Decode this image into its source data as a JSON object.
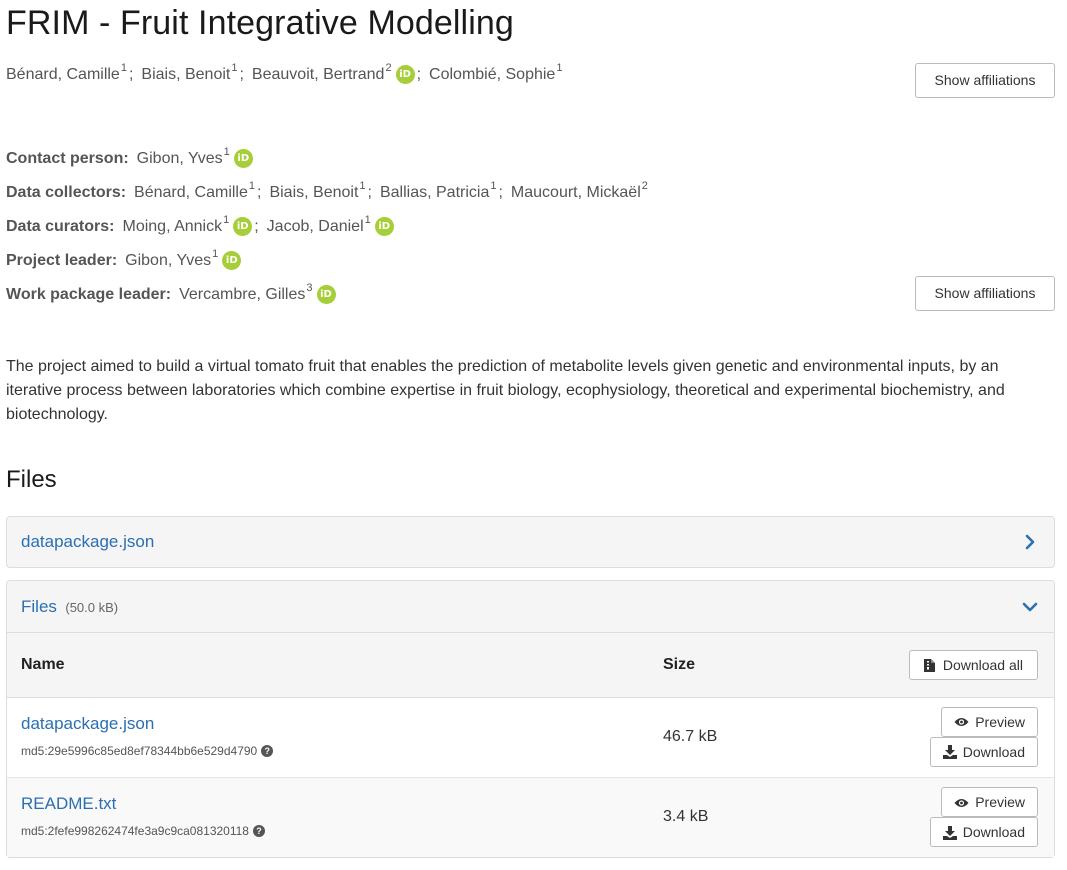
{
  "title": "FRIM - Fruit Integrative Modelling",
  "creators": [
    {
      "name": "Bénard, Camille",
      "aff": "1",
      "orcid": false
    },
    {
      "name": "Biais, Benoit",
      "aff": "1",
      "orcid": false
    },
    {
      "name": "Beauvoit, Bertrand",
      "aff": "2",
      "orcid": true
    },
    {
      "name": "Colombié, Sophie",
      "aff": "1",
      "orcid": false
    }
  ],
  "show_affiliations_label": "Show affiliations",
  "contributors": {
    "contact": {
      "role": "Contact person:",
      "people": [
        {
          "name": "Gibon, Yves",
          "aff": "1"
        }
      ]
    },
    "collectors": {
      "role": "Data collectors:",
      "people": [
        {
          "name": "Bénard, Camille",
          "aff": "1"
        },
        {
          "name": "Biais, Benoit",
          "aff": "1"
        },
        {
          "name": "Ballias, Patricia",
          "aff": "1"
        },
        {
          "name": "Maucourt, Mickaël",
          "aff": "2"
        }
      ]
    },
    "curators": {
      "role": "Data curators:",
      "people": [
        {
          "name": "Moing, Annick",
          "aff": "1"
        },
        {
          "name": "Jacob, Daniel",
          "aff": "1"
        }
      ]
    },
    "leader": {
      "role": "Project leader:",
      "people": [
        {
          "name": "Gibon, Yves",
          "aff": "1"
        }
      ]
    },
    "wp_leader": {
      "role": "Work package leader:",
      "people": [
        {
          "name": "Vercambre, Gilles",
          "aff": "3"
        }
      ]
    }
  },
  "orcid_glyph": "iD",
  "separator": ";",
  "description": "The project aimed to build a virtual tomato fruit that enables the prediction of metabolite levels given genetic and environmental inputs, by an iterative process between laboratories which combine expertise in fruit biology, ecophysiology, theoretical and experimental biochemistry, and biotechnology.",
  "files_heading": "Files",
  "datapackage_panel": {
    "label": "datapackage.json"
  },
  "files_panel": {
    "label": "Files",
    "total_size": "(50.0 kB)",
    "columns": {
      "name": "Name",
      "size": "Size"
    },
    "download_all_label": "Download all",
    "preview_label": "Preview",
    "download_label": "Download",
    "help_glyph": "?",
    "rows": [
      {
        "name": "datapackage.json",
        "md5": "md5:29e5996c85ed8ef78344bb6e529d4790",
        "size": "46.7 kB"
      },
      {
        "name": "README.txt",
        "md5": "md5:2fefe998262474fe3a9c9ca081320118",
        "size": "3.4 kB"
      }
    ]
  },
  "colors": {
    "link": "#2a6fb0",
    "orcid": "#a6ce39",
    "panel_bg": "#f5f5f5",
    "border": "#dddddd"
  }
}
